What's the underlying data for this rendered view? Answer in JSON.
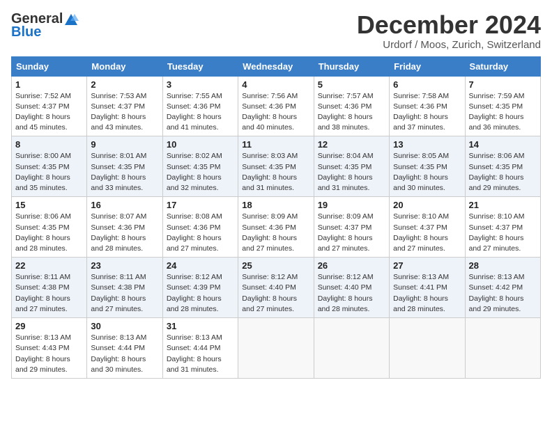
{
  "header": {
    "logo_general": "General",
    "logo_blue": "Blue",
    "month_title": "December 2024",
    "subtitle": "Urdorf / Moos, Zurich, Switzerland"
  },
  "weekdays": [
    "Sunday",
    "Monday",
    "Tuesday",
    "Wednesday",
    "Thursday",
    "Friday",
    "Saturday"
  ],
  "weeks": [
    [
      {
        "day": "1",
        "sunrise": "Sunrise: 7:52 AM",
        "sunset": "Sunset: 4:37 PM",
        "daylight": "Daylight: 8 hours and 45 minutes."
      },
      {
        "day": "2",
        "sunrise": "Sunrise: 7:53 AM",
        "sunset": "Sunset: 4:37 PM",
        "daylight": "Daylight: 8 hours and 43 minutes."
      },
      {
        "day": "3",
        "sunrise": "Sunrise: 7:55 AM",
        "sunset": "Sunset: 4:36 PM",
        "daylight": "Daylight: 8 hours and 41 minutes."
      },
      {
        "day": "4",
        "sunrise": "Sunrise: 7:56 AM",
        "sunset": "Sunset: 4:36 PM",
        "daylight": "Daylight: 8 hours and 40 minutes."
      },
      {
        "day": "5",
        "sunrise": "Sunrise: 7:57 AM",
        "sunset": "Sunset: 4:36 PM",
        "daylight": "Daylight: 8 hours and 38 minutes."
      },
      {
        "day": "6",
        "sunrise": "Sunrise: 7:58 AM",
        "sunset": "Sunset: 4:36 PM",
        "daylight": "Daylight: 8 hours and 37 minutes."
      },
      {
        "day": "7",
        "sunrise": "Sunrise: 7:59 AM",
        "sunset": "Sunset: 4:35 PM",
        "daylight": "Daylight: 8 hours and 36 minutes."
      }
    ],
    [
      {
        "day": "8",
        "sunrise": "Sunrise: 8:00 AM",
        "sunset": "Sunset: 4:35 PM",
        "daylight": "Daylight: 8 hours and 35 minutes."
      },
      {
        "day": "9",
        "sunrise": "Sunrise: 8:01 AM",
        "sunset": "Sunset: 4:35 PM",
        "daylight": "Daylight: 8 hours and 33 minutes."
      },
      {
        "day": "10",
        "sunrise": "Sunrise: 8:02 AM",
        "sunset": "Sunset: 4:35 PM",
        "daylight": "Daylight: 8 hours and 32 minutes."
      },
      {
        "day": "11",
        "sunrise": "Sunrise: 8:03 AM",
        "sunset": "Sunset: 4:35 PM",
        "daylight": "Daylight: 8 hours and 31 minutes."
      },
      {
        "day": "12",
        "sunrise": "Sunrise: 8:04 AM",
        "sunset": "Sunset: 4:35 PM",
        "daylight": "Daylight: 8 hours and 31 minutes."
      },
      {
        "day": "13",
        "sunrise": "Sunrise: 8:05 AM",
        "sunset": "Sunset: 4:35 PM",
        "daylight": "Daylight: 8 hours and 30 minutes."
      },
      {
        "day": "14",
        "sunrise": "Sunrise: 8:06 AM",
        "sunset": "Sunset: 4:35 PM",
        "daylight": "Daylight: 8 hours and 29 minutes."
      }
    ],
    [
      {
        "day": "15",
        "sunrise": "Sunrise: 8:06 AM",
        "sunset": "Sunset: 4:35 PM",
        "daylight": "Daylight: 8 hours and 28 minutes."
      },
      {
        "day": "16",
        "sunrise": "Sunrise: 8:07 AM",
        "sunset": "Sunset: 4:36 PM",
        "daylight": "Daylight: 8 hours and 28 minutes."
      },
      {
        "day": "17",
        "sunrise": "Sunrise: 8:08 AM",
        "sunset": "Sunset: 4:36 PM",
        "daylight": "Daylight: 8 hours and 27 minutes."
      },
      {
        "day": "18",
        "sunrise": "Sunrise: 8:09 AM",
        "sunset": "Sunset: 4:36 PM",
        "daylight": "Daylight: 8 hours and 27 minutes."
      },
      {
        "day": "19",
        "sunrise": "Sunrise: 8:09 AM",
        "sunset": "Sunset: 4:37 PM",
        "daylight": "Daylight: 8 hours and 27 minutes."
      },
      {
        "day": "20",
        "sunrise": "Sunrise: 8:10 AM",
        "sunset": "Sunset: 4:37 PM",
        "daylight": "Daylight: 8 hours and 27 minutes."
      },
      {
        "day": "21",
        "sunrise": "Sunrise: 8:10 AM",
        "sunset": "Sunset: 4:37 PM",
        "daylight": "Daylight: 8 hours and 27 minutes."
      }
    ],
    [
      {
        "day": "22",
        "sunrise": "Sunrise: 8:11 AM",
        "sunset": "Sunset: 4:38 PM",
        "daylight": "Daylight: 8 hours and 27 minutes."
      },
      {
        "day": "23",
        "sunrise": "Sunrise: 8:11 AM",
        "sunset": "Sunset: 4:38 PM",
        "daylight": "Daylight: 8 hours and 27 minutes."
      },
      {
        "day": "24",
        "sunrise": "Sunrise: 8:12 AM",
        "sunset": "Sunset: 4:39 PM",
        "daylight": "Daylight: 8 hours and 28 minutes."
      },
      {
        "day": "25",
        "sunrise": "Sunrise: 8:12 AM",
        "sunset": "Sunset: 4:40 PM",
        "daylight": "Daylight: 8 hours and 27 minutes."
      },
      {
        "day": "26",
        "sunrise": "Sunrise: 8:12 AM",
        "sunset": "Sunset: 4:40 PM",
        "daylight": "Daylight: 8 hours and 28 minutes."
      },
      {
        "day": "27",
        "sunrise": "Sunrise: 8:13 AM",
        "sunset": "Sunset: 4:41 PM",
        "daylight": "Daylight: 8 hours and 28 minutes."
      },
      {
        "day": "28",
        "sunrise": "Sunrise: 8:13 AM",
        "sunset": "Sunset: 4:42 PM",
        "daylight": "Daylight: 8 hours and 29 minutes."
      }
    ],
    [
      {
        "day": "29",
        "sunrise": "Sunrise: 8:13 AM",
        "sunset": "Sunset: 4:43 PM",
        "daylight": "Daylight: 8 hours and 29 minutes."
      },
      {
        "day": "30",
        "sunrise": "Sunrise: 8:13 AM",
        "sunset": "Sunset: 4:44 PM",
        "daylight": "Daylight: 8 hours and 30 minutes."
      },
      {
        "day": "31",
        "sunrise": "Sunrise: 8:13 AM",
        "sunset": "Sunset: 4:44 PM",
        "daylight": "Daylight: 8 hours and 31 minutes."
      },
      null,
      null,
      null,
      null
    ]
  ]
}
